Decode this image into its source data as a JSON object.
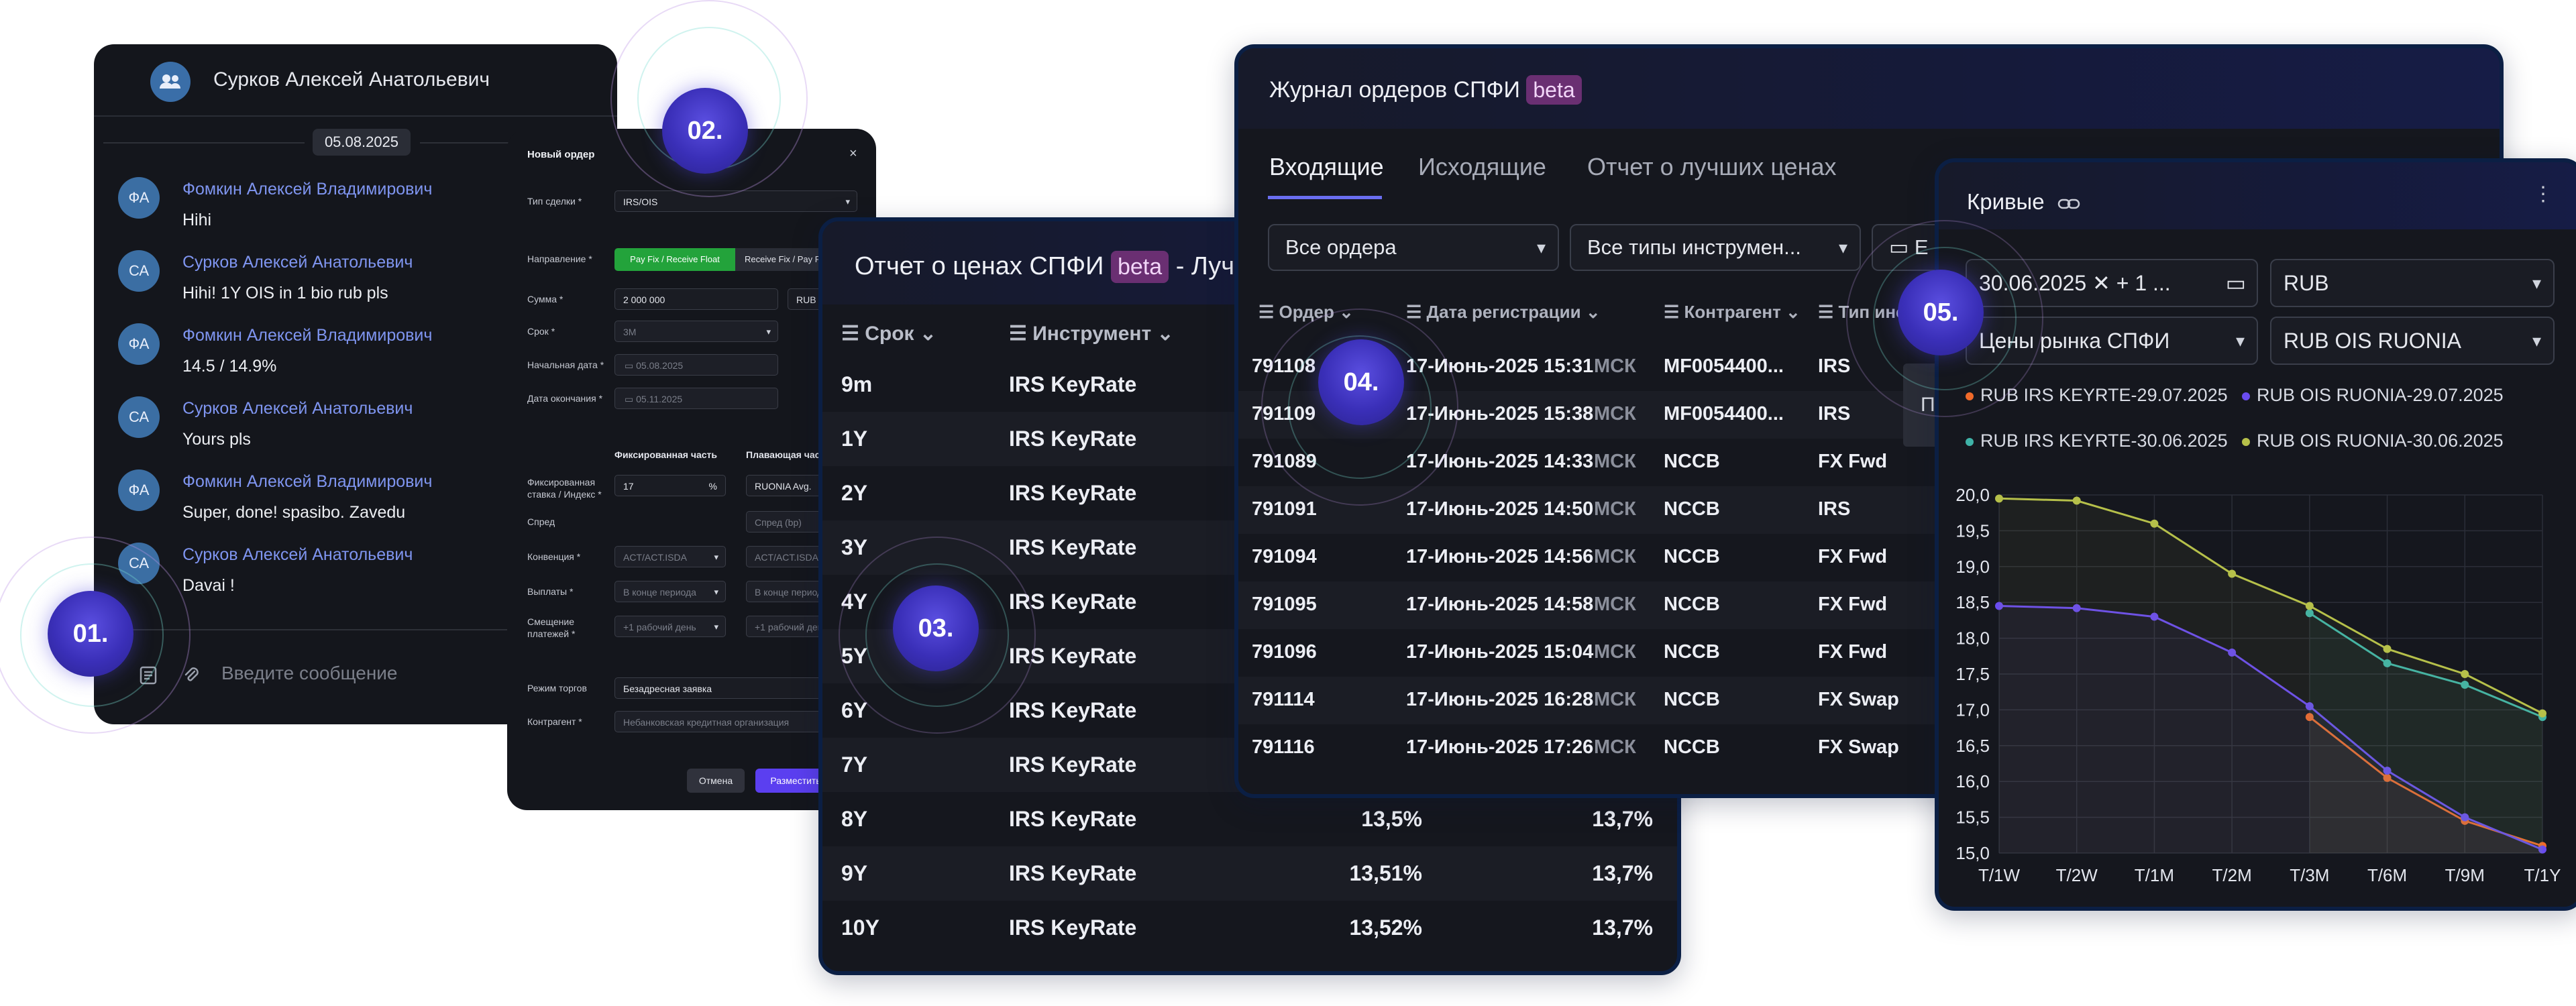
{
  "chat": {
    "title": "Сурков Алексей Анатольевич",
    "date": "05.08.2025",
    "messages": [
      {
        "initials": "ФА",
        "name": "Фомкин Алексей Владимирович",
        "text": "Hihi"
      },
      {
        "initials": "СА",
        "name": "Сурков Алексей Анатольевич",
        "text": "Hihi! 1Y OIS in 1 bio rub pls"
      },
      {
        "initials": "ФА",
        "name": "Фомкин Алексей Владимирович",
        "text": "14.5 / 14.9%"
      },
      {
        "initials": "СА",
        "name": "Сурков Алексей Анатольевич",
        "text": "Yours pls"
      },
      {
        "initials": "ФА",
        "name": "Фомкин Алексей Владимирович",
        "text": "Super, done! spasibo. Zavedu"
      },
      {
        "initials": "СА",
        "name": "Сурков Алексей Анатольевич",
        "text": "Davai !"
      }
    ],
    "input_placeholder": "Введите сообщение"
  },
  "badges": [
    "01.",
    "02.",
    "03.",
    "04.",
    "05."
  ],
  "order": {
    "title": "Новый ордер",
    "close": "×",
    "deal_type_label": "Тип сделки *",
    "deal_type": "IRS/OIS",
    "direction_label": "Направление *",
    "direction_on": "Pay Fix / Receive Float",
    "direction_off": "Receive Fix / Pay Float",
    "amount_label": "Сумма *",
    "amount": "2 000 000",
    "currency": "RUB",
    "term_label": "Срок *",
    "term": "3M",
    "start_label": "Начальная дата *",
    "start": "05.08.2025",
    "end_label": "Дата окончания *",
    "end": "05.11.2025",
    "fixed_part": "Фиксированная часть",
    "float_part": "Плавающая часть",
    "rate_label": "Фиксированная ставка / Индекс *",
    "rate": "17",
    "rate_unit": "%",
    "index": "RUONIA Avg.",
    "spread_label": "Спред",
    "spread_placeholder": "Спред (bp)",
    "convention_label": "Конвенция *",
    "convention": "ACT/ACT.ISDA",
    "payments_label": "Выплаты *",
    "payments": "В конце периода",
    "shift_label": "Смещение платежей *",
    "shift": "+1 рабочий день",
    "mode_label": "Режим торгов",
    "mode": "Безадресная заявка",
    "counterparty_label": "Контрагент *",
    "counterparty": "Небанковская кредитная организация",
    "cancel": "Отмена",
    "place": "Разместить"
  },
  "report": {
    "title_prefix": "Отчет о ценах СПФИ",
    "beta": "beta",
    "title_suffix": "- Лучшие цены",
    "col_term": "Срок",
    "col_instrument": "Инструмент",
    "rows": [
      {
        "term": "9m",
        "instrument": "IRS KeyRate",
        "bid": "",
        "ask": ""
      },
      {
        "term": "1Y",
        "instrument": "IRS KeyRate",
        "bid": "",
        "ask": ""
      },
      {
        "term": "2Y",
        "instrument": "IRS KeyRate",
        "bid": "",
        "ask": ""
      },
      {
        "term": "3Y",
        "instrument": "IRS KeyRate",
        "bid": "",
        "ask": ""
      },
      {
        "term": "4Y",
        "instrument": "IRS KeyRate",
        "bid": "",
        "ask": ""
      },
      {
        "term": "5Y",
        "instrument": "IRS KeyRate",
        "bid": "",
        "ask": ""
      },
      {
        "term": "6Y",
        "instrument": "IRS KeyRate",
        "bid": "",
        "ask": ""
      },
      {
        "term": "7Y",
        "instrument": "IRS KeyRate",
        "bid": "",
        "ask": ""
      },
      {
        "term": "8Y",
        "instrument": "IRS KeyRate",
        "bid": "13,5%",
        "ask": "13,7%"
      },
      {
        "term": "9Y",
        "instrument": "IRS KeyRate",
        "bid": "13,51%",
        "ask": "13,7%"
      },
      {
        "term": "10Y",
        "instrument": "IRS KeyRate",
        "bid": "13,52%",
        "ask": "13,7%"
      }
    ]
  },
  "journal": {
    "title": "Журнал ордеров СПФИ",
    "beta": "beta",
    "tabs": [
      "Входящие",
      "Исходящие",
      "Отчет о лучших ценах"
    ],
    "filter_orders": "Все ордера",
    "filter_types": "Все типы инструмен...",
    "filter_date": "Е",
    "columns": [
      "Ордер",
      "Дата регистрации",
      "Контрагент",
      "Тип инстр"
    ],
    "popup": "Пр",
    "rows": [
      {
        "id": "791108",
        "date": "17-Июнь-2025 15:31",
        "tz": "МСК",
        "cp": "MF0054400...",
        "type": "IRS"
      },
      {
        "id": "791109",
        "date": "17-Июнь-2025 15:38",
        "tz": "МСК",
        "cp": "MF0054400...",
        "type": "IRS"
      },
      {
        "id": "791089",
        "date": "17-Июнь-2025 14:33",
        "tz": "МСК",
        "cp": "NCCB",
        "type": "FX Fwd"
      },
      {
        "id": "791091",
        "date": "17-Июнь-2025 14:50",
        "tz": "МСК",
        "cp": "NCCB",
        "type": "IRS"
      },
      {
        "id": "791094",
        "date": "17-Июнь-2025 14:56",
        "tz": "МСК",
        "cp": "NCCB",
        "type": "FX Fwd"
      },
      {
        "id": "791095",
        "date": "17-Июнь-2025 14:58",
        "tz": "МСК",
        "cp": "NCCB",
        "type": "FX Fwd"
      },
      {
        "id": "791096",
        "date": "17-Июнь-2025 15:04",
        "tz": "МСК",
        "cp": "NCCB",
        "type": "FX Fwd"
      },
      {
        "id": "791114",
        "date": "17-Июнь-2025 16:28",
        "tz": "МСК",
        "cp": "NCCB",
        "type": "FX Swap"
      },
      {
        "id": "791116",
        "date": "17-Июнь-2025 17:26",
        "tz": "МСК",
        "cp": "NCCB",
        "type": "FX Swap"
      }
    ]
  },
  "curves": {
    "title": "Кривые",
    "date": "30.06.2025",
    "date_extra": "+ 1 ...",
    "currency": "RUB",
    "price_source": "Цены рынка СПФИ",
    "curve": "RUB OIS RUONIA"
  },
  "chart_data": {
    "type": "line",
    "title": "",
    "xlabel": "",
    "ylabel": "",
    "categories": [
      "T/1W",
      "T/2W",
      "T/1M",
      "T/2M",
      "T/3M",
      "T/6M",
      "T/9M",
      "T/1Y"
    ],
    "ylim": [
      15.0,
      20.0
    ],
    "y_ticks": [
      "15,0",
      "15,5",
      "16,0",
      "16,5",
      "17,0",
      "17,5",
      "18,0",
      "18,5",
      "19,0",
      "19,5",
      "20,0"
    ],
    "legend_position": "top",
    "grid": true,
    "series": [
      {
        "name": "RUB IRS KEYRTE-29.07.2025",
        "color": "#f06a2a",
        "values": [
          null,
          null,
          null,
          null,
          16.9,
          16.05,
          15.45,
          15.1
        ]
      },
      {
        "name": "RUB OIS RUONIA-29.07.2025",
        "color": "#6a4cf0",
        "values": [
          18.45,
          18.42,
          18.3,
          17.8,
          17.05,
          16.15,
          15.5,
          15.05
        ]
      },
      {
        "name": "RUB IRS KEYRTE-30.06.2025",
        "color": "#3fb3a8",
        "values": [
          null,
          null,
          null,
          null,
          18.35,
          17.65,
          17.35,
          16.9
        ]
      },
      {
        "name": "RUB OIS RUONIA-30.06.2025",
        "color": "#b6c04a",
        "values": [
          19.95,
          19.92,
          19.6,
          18.9,
          18.45,
          17.85,
          17.5,
          16.95
        ]
      }
    ]
  }
}
